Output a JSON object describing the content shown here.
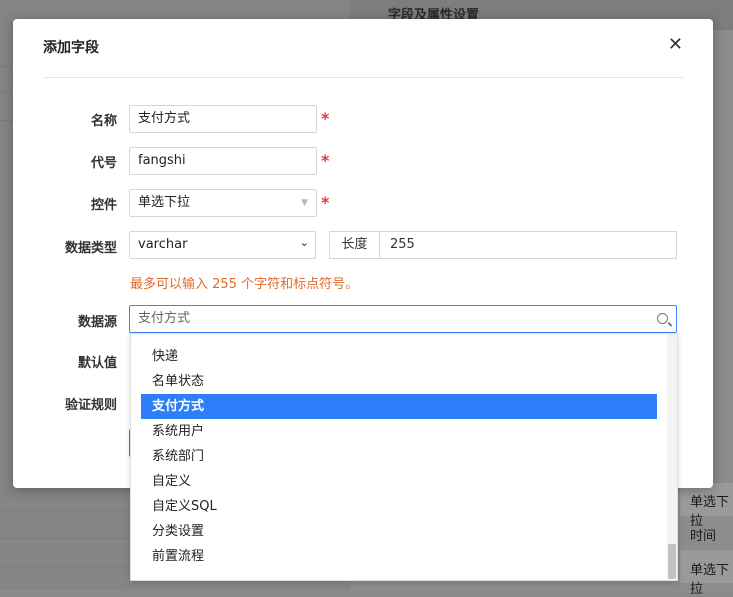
{
  "background": {
    "panel_title": "字段及属性设置",
    "cells": [
      "单选下拉",
      "时间",
      "单选下拉"
    ]
  },
  "modal": {
    "title": "添加字段",
    "fields": {
      "name_label": "名称",
      "name_value": "支付方式",
      "code_label": "代号",
      "code_value": "fangshi",
      "control_label": "控件",
      "control_value": "单选下拉",
      "datatype_label": "数据类型",
      "datatype_value": "varchar",
      "length_label": "长度",
      "length_value": "255",
      "hint": "最多可以输入 255 个字符和标点符号。",
      "datasource_label": "数据源",
      "datasource_value": "支付方式",
      "default_label": "默认值",
      "validation_label": "验证规则"
    }
  },
  "dropdown": {
    "options": [
      "快递",
      "名单状态",
      "支付方式",
      "系统用户",
      "系统部门",
      "自定义",
      "自定义SQL",
      "分类设置",
      "前置流程"
    ],
    "selected": "支付方式"
  }
}
